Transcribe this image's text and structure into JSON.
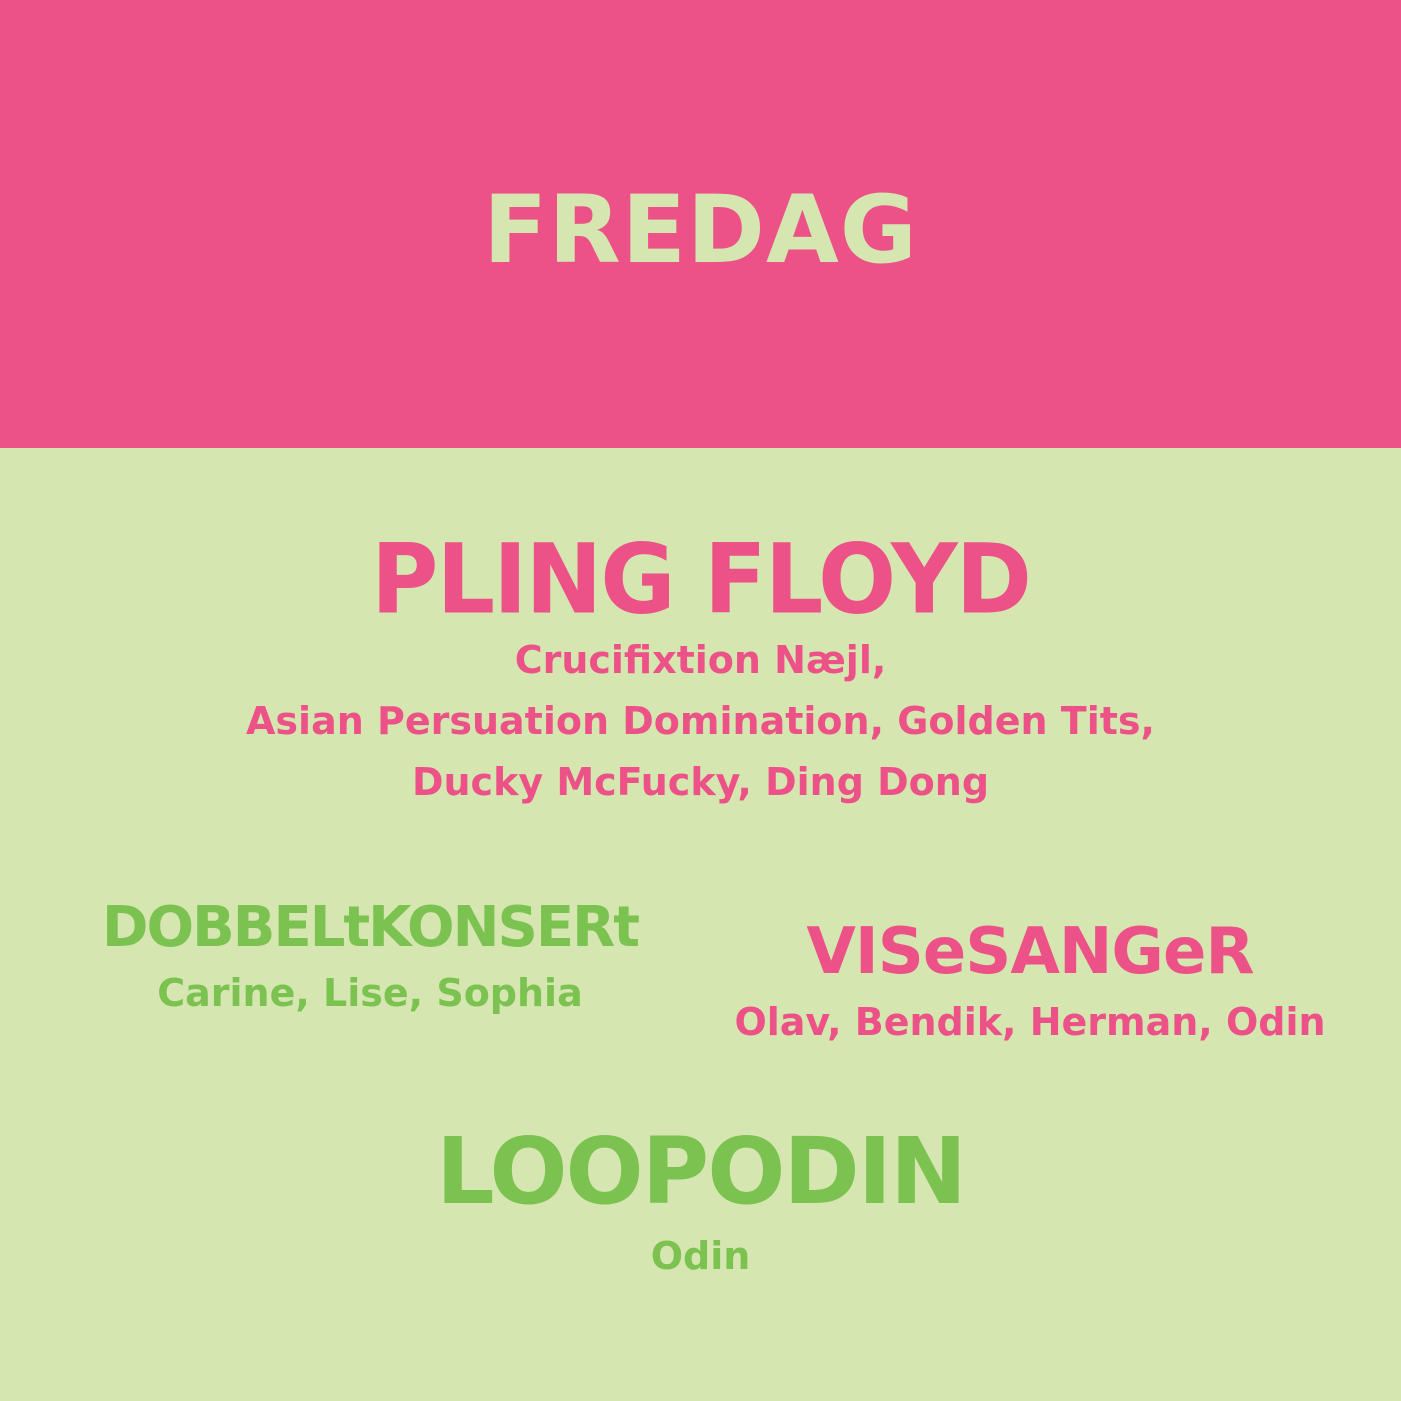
{
  "header": {
    "title": "FREDAG"
  },
  "headliner": {
    "name": "PLING FLOYD",
    "support_lines": [
      "Crucifixtion Næjl,",
      "Asian Persuation Domination, Golden Tits,",
      "Ducky McFucky, Ding Dong"
    ]
  },
  "acts": [
    {
      "name": "DOBBELtKONSERt",
      "members": "Carine, Lise, Sophia"
    },
    {
      "name": "VISeSANGeR",
      "members": "Olav, Bendik, Herman, Odin"
    },
    {
      "name": "LOOPODIN",
      "members": "Odin"
    }
  ],
  "colors": {
    "pink": "#ec5287",
    "green": "#7cc251",
    "background": "#d5e6b0"
  }
}
